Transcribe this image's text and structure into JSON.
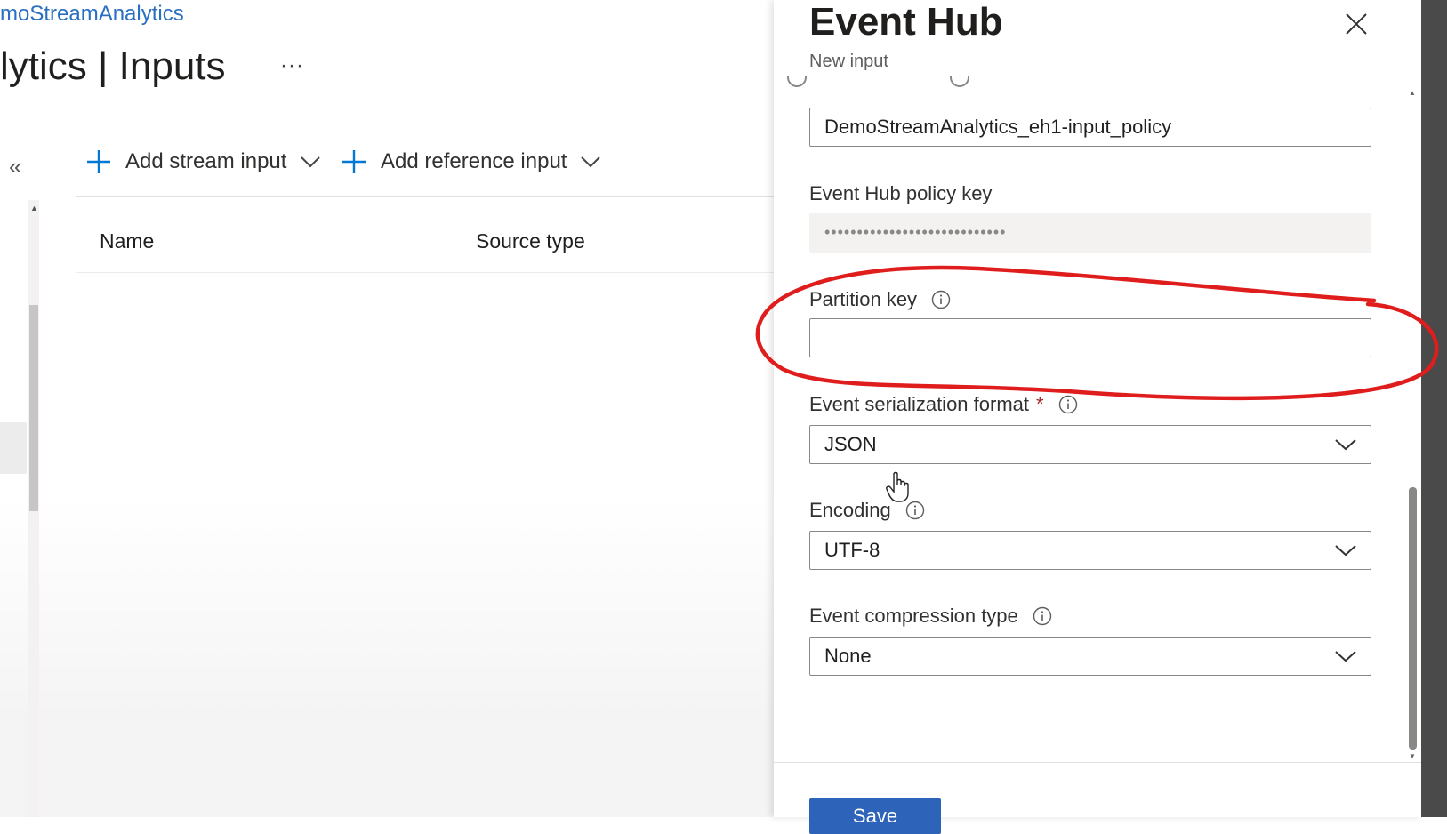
{
  "header": {
    "breadcrumb": "moStreamAnalytics",
    "title": "lytics | Inputs",
    "more": "···"
  },
  "toolbar": {
    "add_stream_input": "Add stream input",
    "add_reference_input": "Add reference input"
  },
  "table": {
    "columns": [
      "Name",
      "Source type"
    ]
  },
  "panel": {
    "title": "Event Hub",
    "subtitle": "New input",
    "policy_name_value": "DemoStreamAnalytics_eh1-input_policy",
    "policy_key_label": "Event Hub policy key",
    "policy_key_value": "••••••••••••••••••••••••••••",
    "partition_key_label": "Partition key",
    "partition_key_value": "",
    "serialization_label": "Event serialization format",
    "required_marker": "*",
    "serialization_value": "JSON",
    "encoding_label": "Encoding",
    "encoding_value": "UTF-8",
    "compression_label": "Event compression type",
    "compression_value": "None",
    "save_label": "Save"
  },
  "colors": {
    "accent": "#0078d4",
    "annotation_red": "#e01d1d",
    "required_red": "#a4262c"
  }
}
